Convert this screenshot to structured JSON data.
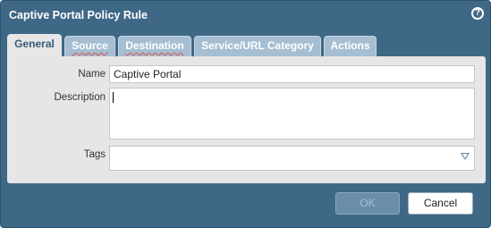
{
  "dialog": {
    "title": "Captive Portal Policy Rule",
    "help_symbol": "?"
  },
  "tabs": [
    {
      "label": "General",
      "active": true
    },
    {
      "label": "Source",
      "active": false
    },
    {
      "label": "Destination",
      "active": false
    },
    {
      "label": "Service/URL Category",
      "active": false
    },
    {
      "label": "Actions",
      "active": false
    }
  ],
  "form": {
    "name_label": "Name",
    "name_value": "Captive Portal",
    "description_label": "Description",
    "description_value": "",
    "tags_label": "Tags",
    "tags_value": ""
  },
  "buttons": {
    "ok_label": "OK",
    "cancel_label": "Cancel"
  },
  "colors": {
    "frame": "#3f6887",
    "tab_inactive": "#a5bed2",
    "panel": "#e6e6e6"
  }
}
